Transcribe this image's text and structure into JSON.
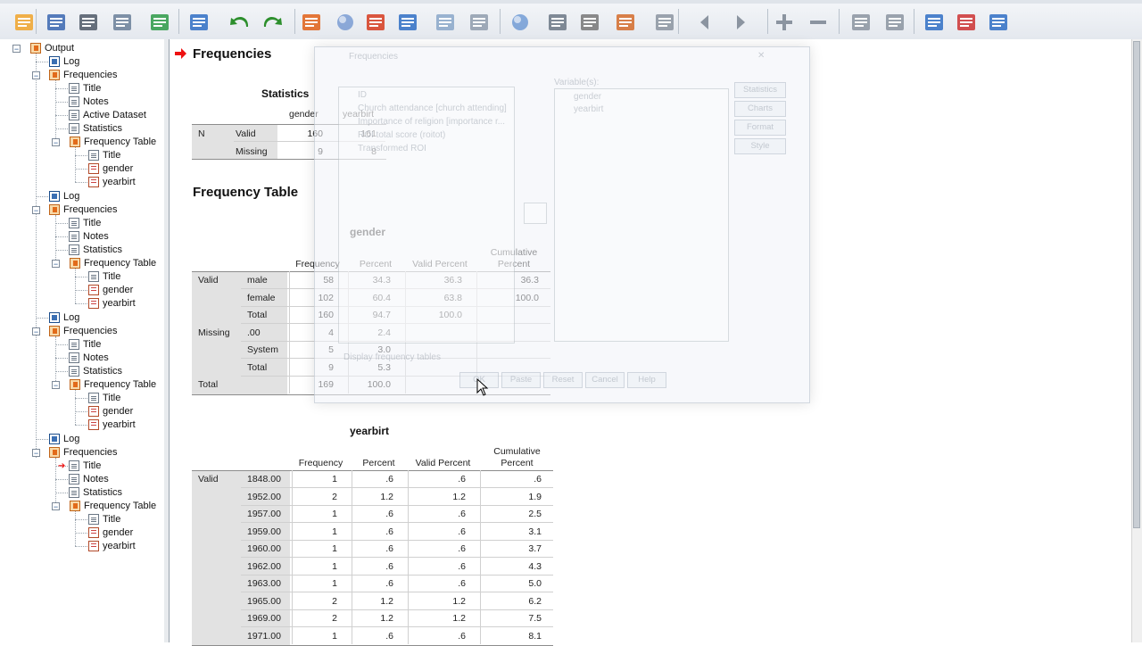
{
  "toolbar": {
    "icons": [
      "open-icon",
      "save-icon",
      "print-icon",
      "print-preview-icon",
      "export-icon",
      "recall-dialog-icon",
      "undo-icon",
      "redo-icon",
      "goto-data-icon",
      "goto-case-icon",
      "goto-variable-icon",
      "variables-icon",
      "value-labels-icon",
      "use-sets-icon",
      "show-all-icon",
      "spell-check-icon",
      "insert-icon",
      "outline-promote-icon",
      "designate-window-icon",
      "previous-icon",
      "next-icon",
      "expand-icon",
      "collapse-icon",
      "show-icon",
      "hide-icon",
      "insert-heading-icon",
      "insert-title-icon",
      "insert-text-icon"
    ]
  },
  "tree": {
    "root": "Output",
    "blocks": [
      {
        "log": "Log",
        "proc": "Frequencies",
        "children": [
          "Title",
          "Notes",
          "Active Dataset",
          "Statistics"
        ],
        "ft": "Frequency Table",
        "ft_children": [
          "Title",
          "gender",
          "yearbirt"
        ]
      },
      {
        "log": "Log",
        "proc": "Frequencies",
        "children": [
          "Title",
          "Notes",
          "Statistics"
        ],
        "ft": "Frequency Table",
        "ft_children": [
          "Title",
          "gender",
          "yearbirt"
        ]
      },
      {
        "log": "Log",
        "proc": "Frequencies",
        "children": [
          "Title",
          "Notes",
          "Statistics"
        ],
        "ft": "Frequency Table",
        "ft_children": [
          "Title",
          "gender",
          "yearbirt"
        ]
      },
      {
        "log": "Log",
        "proc": "Frequencies",
        "children": [
          "Title",
          "Notes",
          "Statistics"
        ],
        "ft": "Frequency Table",
        "ft_children": [
          "Title",
          "gender",
          "yearbirt"
        ]
      }
    ]
  },
  "output": {
    "title": "Frequencies",
    "statistics": {
      "title": "Statistics",
      "col1": "gender",
      "col2": "yearbirt",
      "n": "N",
      "valid": "Valid",
      "missing": "Missing",
      "valid_vals": [
        "160",
        "161"
      ],
      "missing_vals": [
        "9",
        "8"
      ]
    },
    "freq_table_title": "Frequency Table",
    "headers": {
      "frequency": "Frequency",
      "percent": "Percent",
      "valid_percent": "Valid Percent",
      "cum1": "Cumulative",
      "cum2": "Percent"
    },
    "gender": {
      "title": "gender",
      "rows": [
        {
          "g": "Valid",
          "label": "male",
          "f": "58",
          "p": "34.3",
          "vp": "36.3",
          "cp": "36.3"
        },
        {
          "g": "",
          "label": "female",
          "f": "102",
          "p": "60.4",
          "vp": "63.8",
          "cp": "100.0"
        },
        {
          "g": "",
          "label": "Total",
          "f": "160",
          "p": "94.7",
          "vp": "100.0",
          "cp": ""
        },
        {
          "g": "Missing",
          "label": ".00",
          "f": "4",
          "p": "2.4",
          "vp": "",
          "cp": ""
        },
        {
          "g": "",
          "label": "System",
          "f": "5",
          "p": "3.0",
          "vp": "",
          "cp": ""
        },
        {
          "g": "",
          "label": "Total",
          "f": "9",
          "p": "5.3",
          "vp": "",
          "cp": ""
        },
        {
          "g": "Total",
          "label": "",
          "f": "169",
          "p": "100.0",
          "vp": "",
          "cp": ""
        }
      ]
    },
    "yearbirt": {
      "title": "yearbirt",
      "group": "Valid",
      "rows": [
        {
          "label": "1848.00",
          "f": "1",
          "p": ".6",
          "vp": ".6",
          "cp": ".6"
        },
        {
          "label": "1952.00",
          "f": "2",
          "p": "1.2",
          "vp": "1.2",
          "cp": "1.9"
        },
        {
          "label": "1957.00",
          "f": "1",
          "p": ".6",
          "vp": ".6",
          "cp": "2.5"
        },
        {
          "label": "1959.00",
          "f": "1",
          "p": ".6",
          "vp": ".6",
          "cp": "3.1"
        },
        {
          "label": "1960.00",
          "f": "1",
          "p": ".6",
          "vp": ".6",
          "cp": "3.7"
        },
        {
          "label": "1962.00",
          "f": "1",
          "p": ".6",
          "vp": ".6",
          "cp": "4.3"
        },
        {
          "label": "1963.00",
          "f": "1",
          "p": ".6",
          "vp": ".6",
          "cp": "5.0"
        },
        {
          "label": "1965.00",
          "f": "2",
          "p": "1.2",
          "vp": "1.2",
          "cp": "6.2"
        },
        {
          "label": "1969.00",
          "f": "2",
          "p": "1.2",
          "vp": "1.2",
          "cp": "7.5"
        },
        {
          "label": "1971.00",
          "f": "1",
          "p": ".6",
          "vp": ".6",
          "cp": "8.1"
        }
      ]
    }
  },
  "dialog": {
    "title": "Frequencies",
    "variables_label": "Variable(s):",
    "source_list": [
      "ID",
      "Church attendance [church attending]",
      "Importance of religion [importance r...",
      "ROI total score (roitot)",
      "Transformed ROI"
    ],
    "target_list": [
      "gender",
      "yearbirt"
    ],
    "side_buttons": [
      "Statistics",
      "Charts",
      "Format",
      "Style"
    ],
    "checkbox": "Display frequency tables",
    "buttons": [
      "OK",
      "Paste",
      "Reset",
      "Cancel",
      "Help"
    ]
  }
}
